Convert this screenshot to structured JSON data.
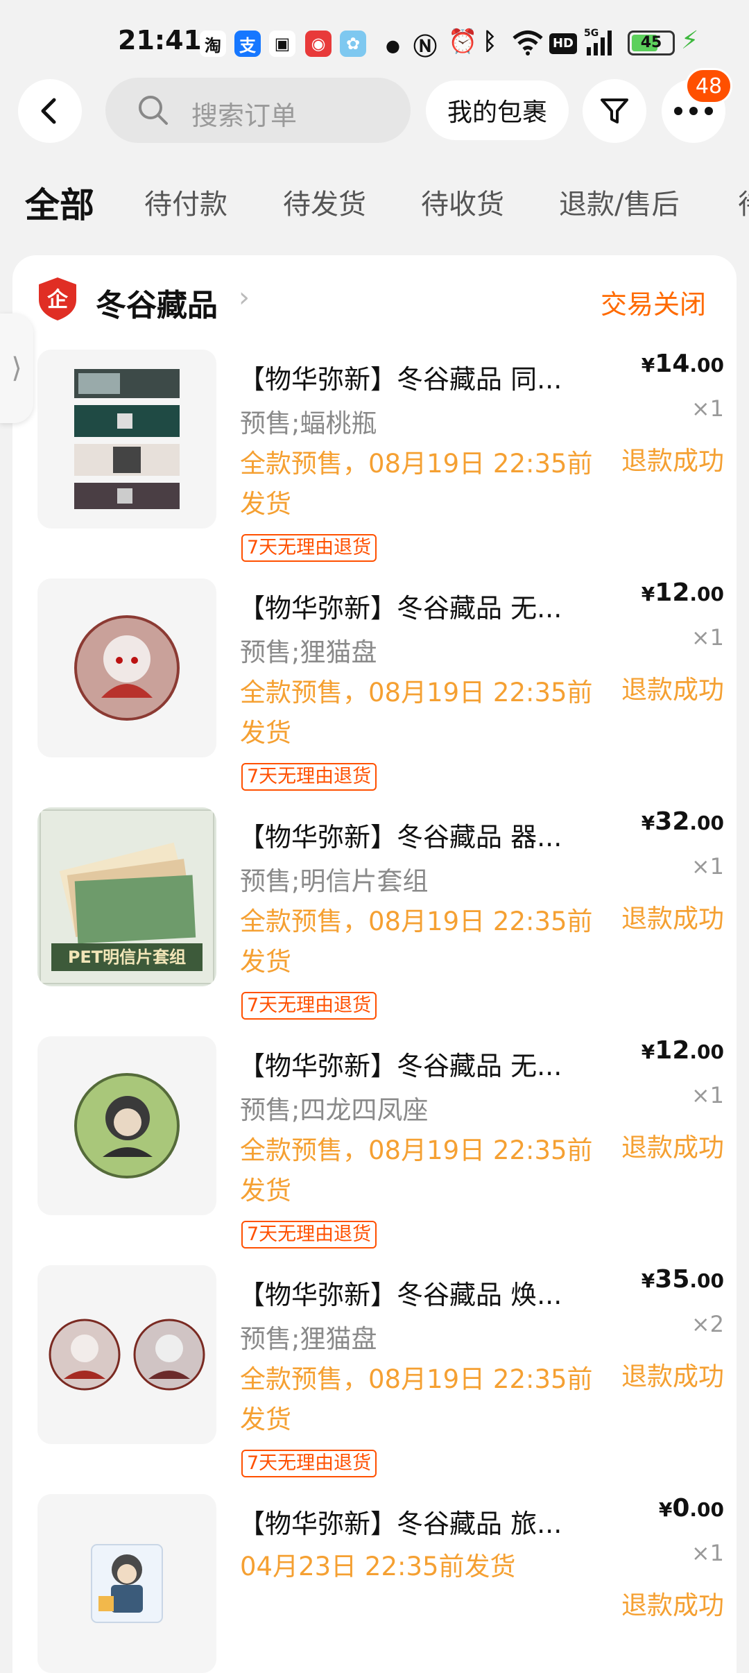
{
  "status_bar": {
    "time": "21:41",
    "apps": [
      {
        "icon": "taobao-icon",
        "glyph": "淘",
        "color": "#ffffff",
        "text_color": "#111111"
      },
      {
        "icon": "alipay-icon",
        "glyph": "支",
        "color": "#1677ff",
        "text_color": "#ffffff"
      },
      {
        "icon": "bilibili-icon",
        "glyph": "▣",
        "color": "#ffffff",
        "text_color": "#111111"
      },
      {
        "icon": "netease-music-icon",
        "glyph": "◉",
        "color": "#e83a3a",
        "text_color": "#ffffff"
      },
      {
        "icon": "rabbit-app-icon",
        "glyph": "✿",
        "color": "#7ec8f0",
        "text_color": "#ffffff"
      }
    ],
    "battery": "45"
  },
  "header": {
    "search_placeholder": "搜索订单",
    "my_packages": "我的包裹",
    "badge_count": "48"
  },
  "tabs": [
    "全部",
    "待付款",
    "待发货",
    "待收货",
    "退款/售后",
    "待"
  ],
  "shop": {
    "name": "冬谷藏品",
    "logo_char": "企",
    "order_status": "交易关闭"
  },
  "items": [
    {
      "title": "【物华弥新】冬谷藏品 同...",
      "sku": "预售;蝠桃瓶",
      "shipping": "全款预售，08月19日 22:35前发货",
      "tag": "7天无理由退货",
      "price_currency": "¥",
      "price_int": "14",
      "price_dec": ".00",
      "qty": "×1",
      "refund": "退款成功",
      "thumb": "strips"
    },
    {
      "title": "【物华弥新】冬谷藏品 无...",
      "sku": "预售;狸猫盘",
      "shipping": "全款预售，08月19日 22:35前发货",
      "tag": "7天无理由退货",
      "price_currency": "¥",
      "price_int": "12",
      "price_dec": ".00",
      "qty": "×1",
      "refund": "退款成功",
      "thumb": "badge-red"
    },
    {
      "title": "【物华弥新】冬谷藏品 器...",
      "sku": "预售;明信片套组",
      "shipping": "全款预售，08月19日 22:35前发货",
      "tag": "7天无理由退货",
      "price_currency": "¥",
      "price_int": "32",
      "price_dec": ".00",
      "qty": "×1",
      "refund": "退款成功",
      "thumb": "postcards",
      "thumb_caption": "PET明信片套组"
    },
    {
      "title": "【物华弥新】冬谷藏品 无...",
      "sku": "预售;四龙四凤座",
      "shipping": "全款预售，08月19日 22:35前发货",
      "tag": "7天无理由退货",
      "price_currency": "¥",
      "price_int": "12",
      "price_dec": ".00",
      "qty": "×1",
      "refund": "退款成功",
      "thumb": "badge-green"
    },
    {
      "title": "【物华弥新】冬谷藏品 焕...",
      "sku": "预售;狸猫盘",
      "shipping": "全款预售，08月19日 22:35前发货",
      "tag": "7天无理由退货",
      "price_currency": "¥",
      "price_int": "35",
      "price_dec": ".00",
      "qty": "×2",
      "refund": "退款成功",
      "thumb": "badge-pair"
    },
    {
      "title": "【物华弥新】冬谷藏品 旅...",
      "sku": "",
      "shipping": "04月23日 22:35前发货",
      "tag": "",
      "price_currency": "¥",
      "price_int": "0",
      "price_dec": ".00",
      "qty": "×1",
      "refund": "退款成功",
      "thumb": "acrylic"
    }
  ],
  "colors": {
    "accent_orange": "#ff6a00",
    "ship_orange": "#f5a032",
    "tag_red": "#ff5000",
    "shop_logo_red": "#e02e24"
  }
}
